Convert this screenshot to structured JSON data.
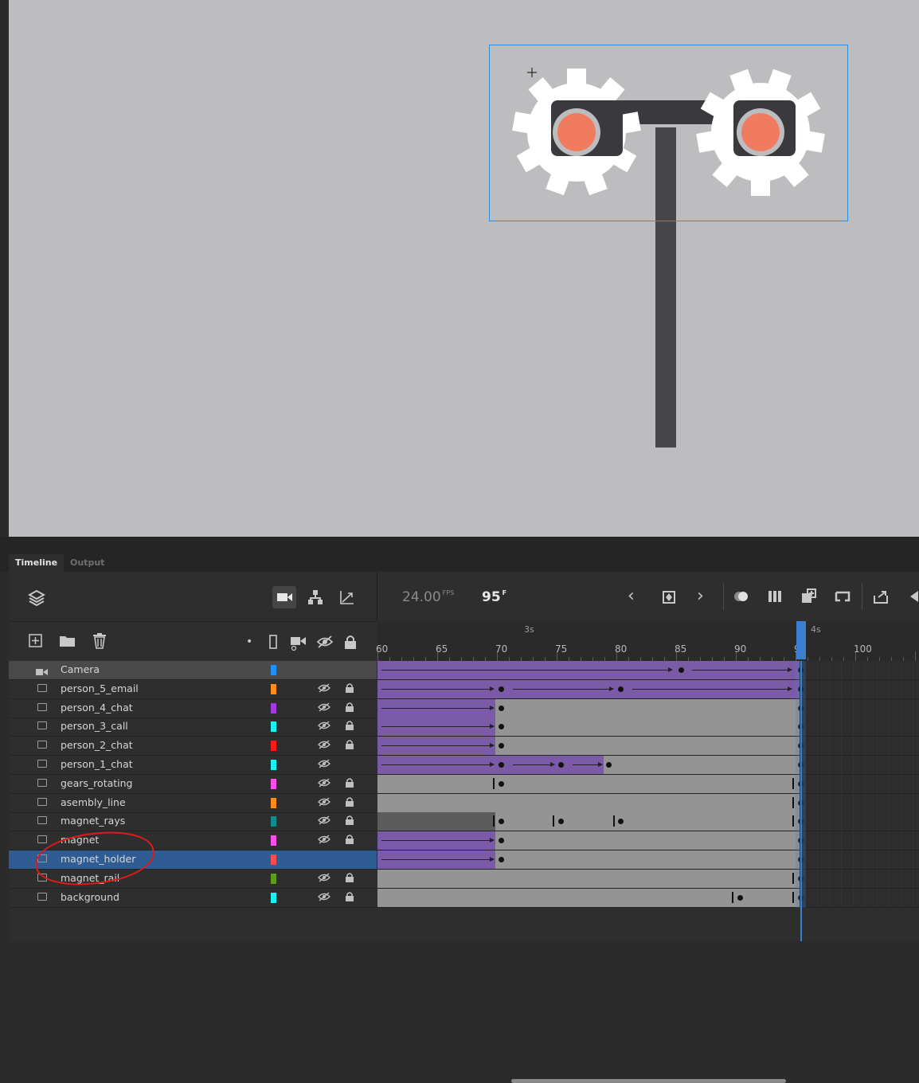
{
  "stage": {
    "background": "#bdbdbf",
    "selection_color": "#2d8fe3",
    "gear_color": "#ffffff",
    "magnet_color": "#3f3f43",
    "dot_color": "#f07b5f"
  },
  "tabs": [
    {
      "label": "Timeline"
    },
    {
      "label": "Output"
    }
  ],
  "toolbar": {
    "fps_value": "24.00",
    "fps_unit": "FPS",
    "frame_value": "95",
    "frame_unit": "F",
    "icons": [
      "layers-icon",
      "camera-icon",
      "hierarchy-icon",
      "graph-icon",
      "prev-keyframe-icon",
      "insert-keyframe-icon",
      "next-keyframe-icon",
      "onion-skin-icon",
      "edit-multiple-frames-icon",
      "add-frame-icon",
      "loop-icon",
      "export-icon",
      "play-back-icon"
    ]
  },
  "layer_header_icons": [
    "new-layer-icon",
    "new-folder-icon",
    "delete-icon",
    "dot-icon",
    "outline-icon",
    "attach-camera-icon",
    "eye-hidden-icon",
    "lock-icon"
  ],
  "ruler": {
    "labels": [
      "60",
      "65",
      "70",
      "75",
      "80",
      "85",
      "90",
      "95",
      "100"
    ],
    "seconds": [
      "3s",
      "4s"
    ]
  },
  "layers": [
    {
      "name": "Camera",
      "color": "#1e90ff",
      "hidden": false,
      "locked": false
    },
    {
      "name": "person_5_email",
      "color": "#ff8c1a",
      "hidden": true,
      "locked": true
    },
    {
      "name": "person_4_chat",
      "color": "#a339e0",
      "hidden": true,
      "locked": true
    },
    {
      "name": "person_3_call",
      "color": "#19f5f5",
      "hidden": true,
      "locked": true
    },
    {
      "name": "person_2_chat",
      "color": "#ff1a1a",
      "hidden": true,
      "locked": true
    },
    {
      "name": "person_1_chat",
      "color": "#19f5f5",
      "hidden": true,
      "locked": false
    },
    {
      "name": "gears_rotating",
      "color": "#ff4df0",
      "hidden": true,
      "locked": true
    },
    {
      "name": "asembly_line",
      "color": "#ff8c1a",
      "hidden": true,
      "locked": true
    },
    {
      "name": "magnet_rays",
      "color": "#0f8c8c",
      "hidden": true,
      "locked": true
    },
    {
      "name": "magnet",
      "color": "#ff4df0",
      "hidden": true,
      "locked": true
    },
    {
      "name": "magnet_holder",
      "color": "#ff4d4d",
      "hidden": false,
      "locked": false
    },
    {
      "name": "magnet_rail",
      "color": "#5c9e1a",
      "hidden": true,
      "locked": true
    },
    {
      "name": "background",
      "color": "#19f5f5",
      "hidden": true,
      "locked": true
    }
  ],
  "selected_layer": "magnet_holder",
  "current_frame": 95
}
